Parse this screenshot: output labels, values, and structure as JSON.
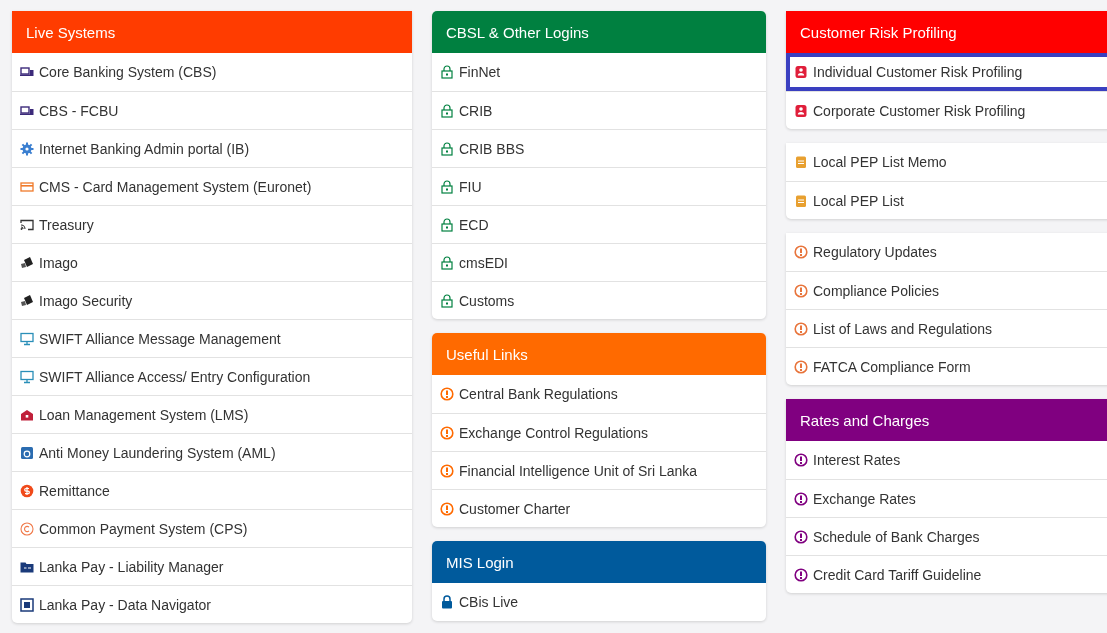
{
  "columns": [
    {
      "sections": [
        {
          "title": "Live Systems",
          "color": "#ff3c00",
          "items": [
            {
              "label": "Core Banking System (CBS)",
              "kind": "laptop",
              "selected": false
            },
            {
              "label": "CBS - FCBU",
              "kind": "laptop",
              "selected": false
            },
            {
              "label": "Internet Banking Admin portal (IB)",
              "kind": "gear",
              "selected": false
            },
            {
              "label": "CMS - Card Management System (Euronet)",
              "kind": "card",
              "selected": false
            },
            {
              "label": "Treasury",
              "kind": "cast",
              "selected": false
            },
            {
              "label": "Imago",
              "kind": "tiles",
              "selected": false
            },
            {
              "label": "Imago Security",
              "kind": "tiles",
              "selected": false
            },
            {
              "label": "SWIFT Alliance Message Management",
              "kind": "monitor",
              "selected": false
            },
            {
              "label": "SWIFT Alliance Access/ Entry Configuration",
              "kind": "monitor",
              "selected": false
            },
            {
              "label": "Loan Management System (LMS)",
              "kind": "shop",
              "selected": false
            },
            {
              "label": "Anti Money Laundering System (AML)",
              "kind": "square",
              "selected": false
            },
            {
              "label": "Remittance",
              "kind": "dollar",
              "selected": false
            },
            {
              "label": "Common Payment System (CPS)",
              "kind": "ring",
              "selected": false
            },
            {
              "label": "Lanka Pay - Liability Manager",
              "kind": "folder",
              "selected": false
            },
            {
              "label": "Lanka Pay - Data Navigator",
              "kind": "frame",
              "selected": false
            }
          ]
        }
      ]
    },
    {
      "sections": [
        {
          "title": "CBSL & Other Logins",
          "color": "#008040",
          "items": [
            {
              "label": "FinNet",
              "kind": "lock",
              "selected": false
            },
            {
              "label": "CRIB",
              "kind": "lock",
              "selected": false
            },
            {
              "label": "CRIB BBS",
              "kind": "lock",
              "selected": false
            },
            {
              "label": "FIU",
              "kind": "lock",
              "selected": false
            },
            {
              "label": "ECD",
              "kind": "lock",
              "selected": false
            },
            {
              "label": "cmsEDI",
              "kind": "lock",
              "selected": false
            },
            {
              "label": "Customs",
              "kind": "lock",
              "selected": false
            }
          ]
        },
        {
          "title": "Useful Links",
          "color": "#ff6a00",
          "items": [
            {
              "label": "Central Bank Regulations",
              "kind": "info",
              "selected": false
            },
            {
              "label": "Exchange Control Regulations",
              "kind": "info",
              "selected": false
            },
            {
              "label": "Financial Intelligence Unit of Sri Lanka",
              "kind": "info",
              "selected": false
            },
            {
              "label": "Customer Charter",
              "kind": "info",
              "selected": false
            }
          ]
        },
        {
          "title": "MIS Login",
          "color": "#005a9c",
          "items": [
            {
              "label": "CBis Live",
              "kind": "padlock",
              "selected": false
            }
          ]
        }
      ]
    },
    {
      "sections": [
        {
          "title": "Customer Risk Profiling",
          "color": "#ff0000",
          "items": [
            {
              "label": "Individual Customer Risk Profiling",
              "kind": "user",
              "selected": true
            },
            {
              "label": "Corporate Customer Risk Profiling",
              "kind": "user",
              "selected": false
            }
          ]
        },
        {
          "color": "#e8a030",
          "items": [
            {
              "label": "Local PEP List Memo",
              "kind": "note",
              "selected": false
            },
            {
              "label": "Local PEP List",
              "kind": "note",
              "selected": false
            }
          ]
        },
        {
          "color": "#e8743b",
          "items": [
            {
              "label": "Regulatory Updates",
              "kind": "info",
              "selected": false
            },
            {
              "label": "Compliance Policies",
              "kind": "info",
              "selected": false
            },
            {
              "label": "List of Laws and Regulations",
              "kind": "info",
              "selected": false
            },
            {
              "label": "FATCA Compliance Form",
              "kind": "info",
              "selected": false
            }
          ]
        },
        {
          "title": "Rates and Charges",
          "color": "#800080",
          "items": [
            {
              "label": "Interest Rates",
              "kind": "info",
              "selected": false
            },
            {
              "label": "Exchange Rates",
              "kind": "info",
              "selected": false
            },
            {
              "label": "Schedule of Bank Charges",
              "kind": "info",
              "selected": false
            },
            {
              "label": "Credit Card Tariff Guideline",
              "kind": "info",
              "selected": false
            }
          ]
        }
      ]
    }
  ]
}
